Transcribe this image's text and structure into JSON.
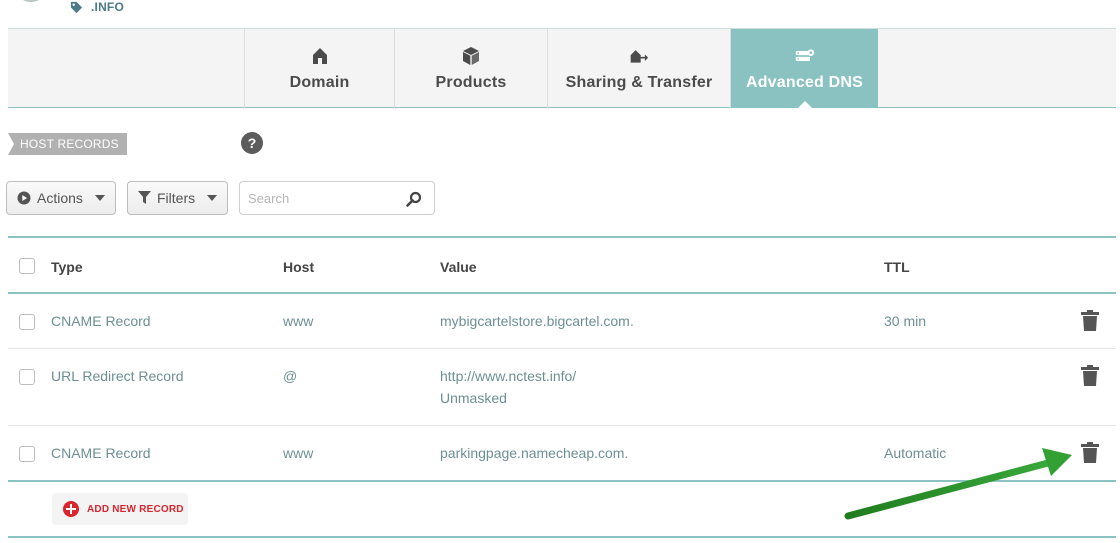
{
  "header": {
    "tld": ".INFO"
  },
  "tabs": [
    {
      "label": "Domain",
      "icon": "home-icon",
      "active": false
    },
    {
      "label": "Products",
      "icon": "box-icon",
      "active": false
    },
    {
      "label": "Sharing & Transfer",
      "icon": "transfer-icon",
      "active": false
    },
    {
      "label": "Advanced DNS",
      "icon": "dns-server-icon",
      "active": true
    }
  ],
  "section": {
    "title": "HOST RECORDS",
    "help": "?"
  },
  "toolbar": {
    "actions_label": "Actions",
    "filters_label": "Filters",
    "search_placeholder": "Search"
  },
  "table": {
    "columns": [
      "Type",
      "Host",
      "Value",
      "TTL"
    ],
    "rows": [
      {
        "type": "CNAME Record",
        "host": "www",
        "value": "mybigcartelstore.bigcartel.com.",
        "value2": "",
        "ttl": "30 min"
      },
      {
        "type": "URL Redirect Record",
        "host": "@",
        "value": "http://www.nctest.info/",
        "value2": "Unmasked",
        "ttl": ""
      },
      {
        "type": "CNAME Record",
        "host": "www",
        "value": "parkingpage.namecheap.com.",
        "value2": "",
        "ttl": "Automatic"
      }
    ]
  },
  "add_record_label": "ADD NEW RECORD",
  "colors": {
    "accent": "#8ac2c1",
    "link_text": "#6d8f94",
    "danger": "#d8262f",
    "annotation_arrow": "#2e9a2e"
  }
}
